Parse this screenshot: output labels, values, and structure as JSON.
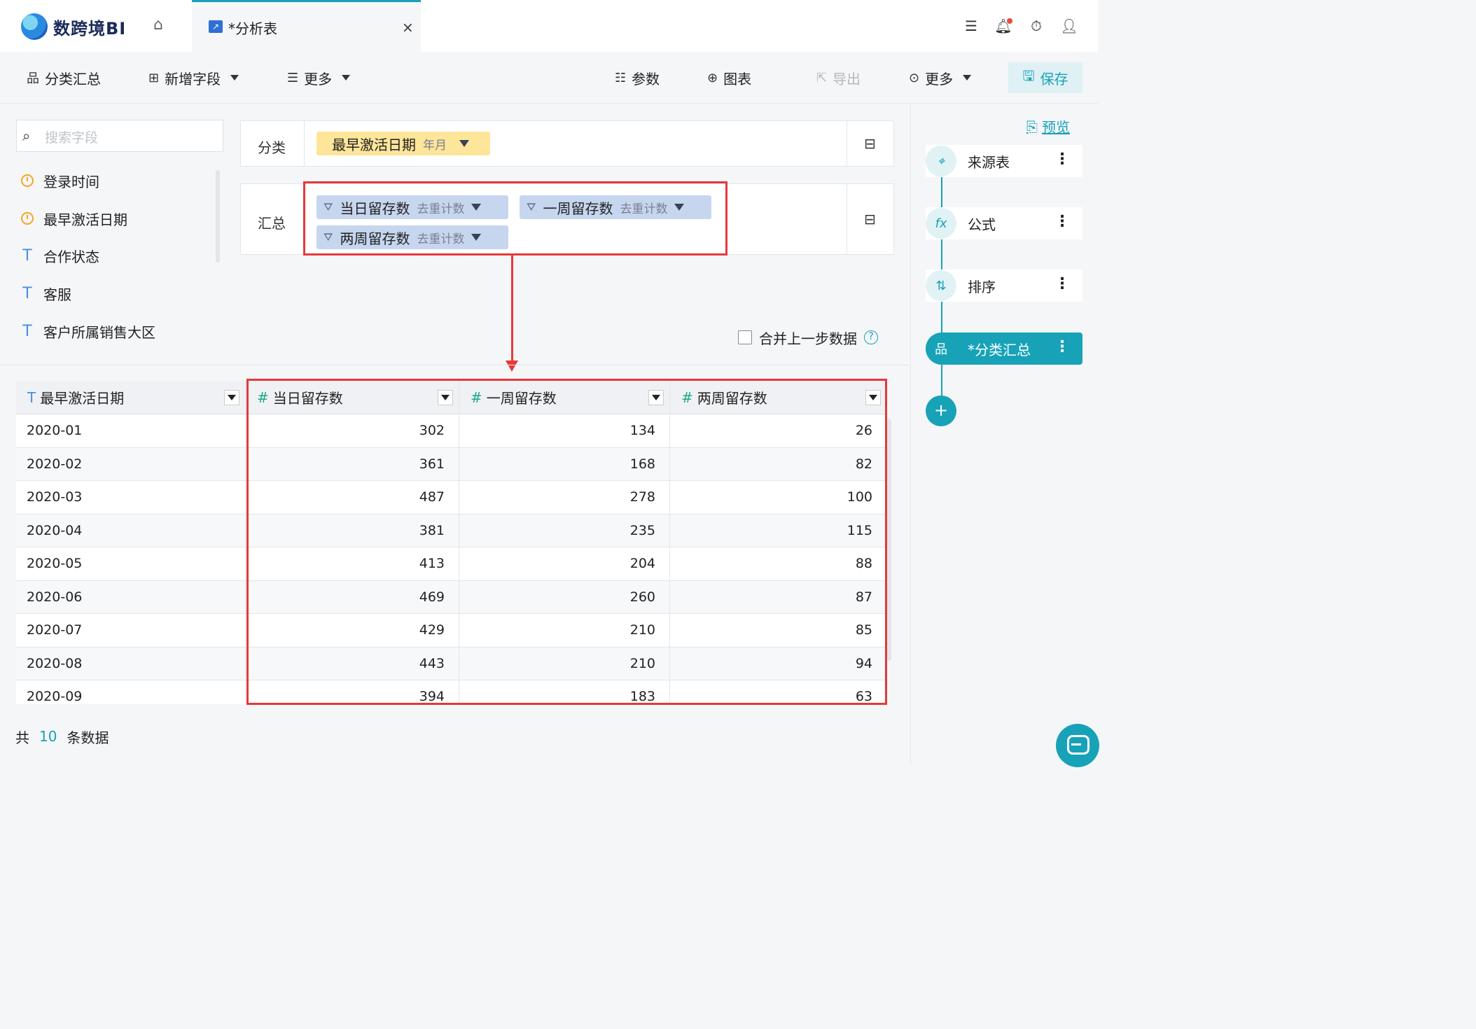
{
  "app": {
    "name": "数跨境BI"
  },
  "tab": {
    "title": "*分析表",
    "close": "×"
  },
  "toolbar": {
    "group_summary": "分类汇总",
    "add_field": "新增字段",
    "more_left": "更多",
    "params": "参数",
    "chart": "图表",
    "export": "导出",
    "more_right": "更多",
    "save": "保存"
  },
  "search": {
    "placeholder": "搜索字段"
  },
  "fields": [
    {
      "name": "登录时间",
      "type": "date"
    },
    {
      "name": "最早激活日期",
      "type": "date"
    },
    {
      "name": "合作状态",
      "type": "text"
    },
    {
      "name": "客服",
      "type": "text"
    },
    {
      "name": "客户所属销售大区",
      "type": "text"
    }
  ],
  "config": {
    "category_label": "分类",
    "category_chip": {
      "name": "最早激活日期",
      "sub": "年月"
    },
    "summary_label": "汇总",
    "summary_chips": [
      {
        "name": "当日留存数",
        "sub": "去重计数"
      },
      {
        "name": "一周留存数",
        "sub": "去重计数"
      },
      {
        "name": "两周留存数",
        "sub": "去重计数"
      }
    ],
    "merge_label": "合并上一步数据",
    "help": "?"
  },
  "table": {
    "columns": [
      {
        "type_icon": "T",
        "name": "最早激活日期"
      },
      {
        "type_icon": "#",
        "name": "当日留存数"
      },
      {
        "type_icon": "#",
        "name": "一周留存数"
      },
      {
        "type_icon": "#",
        "name": "两周留存数"
      }
    ],
    "rows": [
      [
        "2020-01",
        "302",
        "134",
        "26"
      ],
      [
        "2020-02",
        "361",
        "168",
        "82"
      ],
      [
        "2020-03",
        "487",
        "278",
        "100"
      ],
      [
        "2020-04",
        "381",
        "235",
        "115"
      ],
      [
        "2020-05",
        "413",
        "204",
        "88"
      ],
      [
        "2020-06",
        "469",
        "260",
        "87"
      ],
      [
        "2020-07",
        "429",
        "210",
        "85"
      ],
      [
        "2020-08",
        "443",
        "210",
        "94"
      ],
      [
        "2020-09",
        "394",
        "183",
        "63"
      ]
    ]
  },
  "footer": {
    "prefix": "共",
    "count": "10",
    "suffix": "条数据"
  },
  "steps": {
    "preview": "预览",
    "items": [
      {
        "label": "来源表",
        "icon": "target-icon"
      },
      {
        "label": "公式",
        "icon": "fx-icon"
      },
      {
        "label": "排序",
        "icon": "sort-icon"
      },
      {
        "label": "*分类汇总",
        "icon": "group-summary-icon",
        "active": true
      }
    ],
    "add": "+"
  },
  "colors": {
    "accent": "#17a2b8",
    "highlight": "#e5393b"
  }
}
